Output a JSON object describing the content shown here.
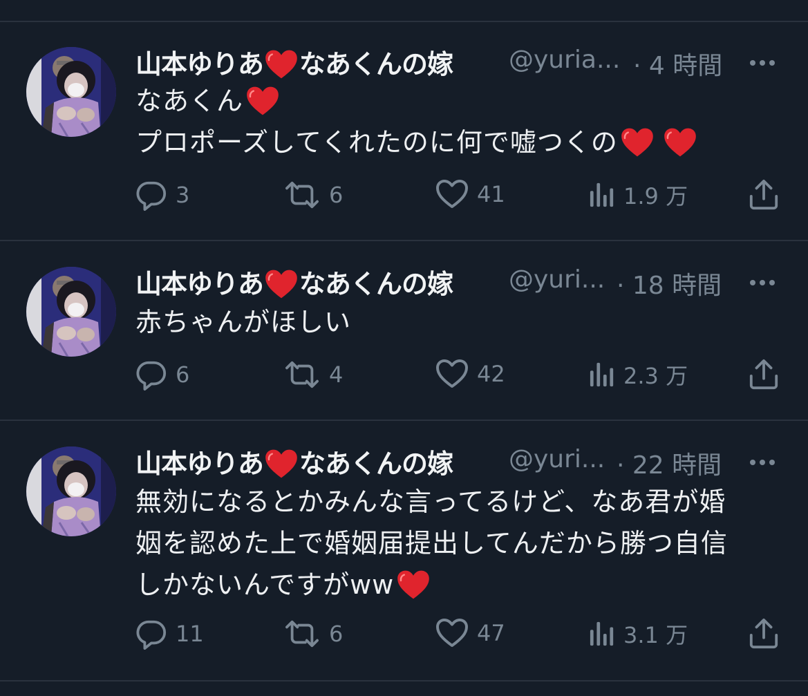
{
  "colors": {
    "background": "#151d28",
    "muted": "#7a8794",
    "text": "#eef0f2",
    "heart": "#e0242d"
  },
  "tweets": [
    {
      "name": "山本ゆりあ",
      "name_suffix": "なあくんの嫁",
      "handle": "@yuria...",
      "time": "· 4 時間",
      "lines": [
        "なあくん",
        "プロポーズしてくれたのに何で嘘つくの"
      ],
      "replies": "3",
      "retweets": "6",
      "likes": "41",
      "views": "1.9 万"
    },
    {
      "name": "山本ゆりあ",
      "name_suffix": "なあくんの嫁",
      "handle": "@yuri...",
      "time": "· 18 時間",
      "lines": [
        "赤ちゃんがほしい"
      ],
      "replies": "6",
      "retweets": "4",
      "likes": "42",
      "views": "2.3 万"
    },
    {
      "name": "山本ゆりあ",
      "name_suffix": "なあくんの嫁",
      "handle": "@yuri...",
      "time": "· 22 時間",
      "lines": [
        "無効になるとかみんな言ってるけど、なあ君が婚",
        "姻を認めた上で婚姻届提出してんだから勝つ自信",
        "しかないんですがww"
      ],
      "replies": "11",
      "retweets": "6",
      "likes": "47",
      "views": "3.1 万"
    }
  ]
}
